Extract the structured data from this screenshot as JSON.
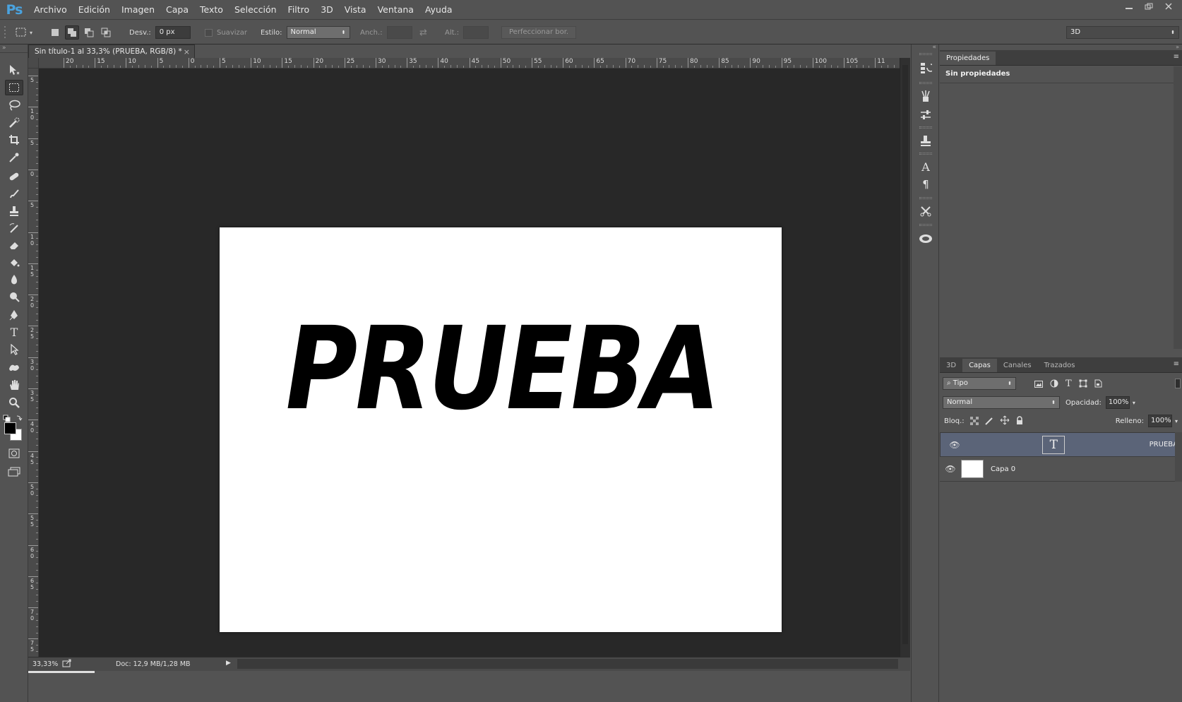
{
  "app": {
    "logo": "Ps"
  },
  "menu": [
    "Archivo",
    "Edición",
    "Imagen",
    "Capa",
    "Texto",
    "Selección",
    "Filtro",
    "3D",
    "Vista",
    "Ventana",
    "Ayuda"
  ],
  "options": {
    "feather_label": "Desv.:",
    "feather_value": "0 px",
    "antialias_label": "Suavizar",
    "style_label": "Estilo:",
    "style_value": "Normal",
    "width_label": "Anch.:",
    "height_label": "Alt.:",
    "refine_label": "Perfeccionar bor.",
    "workspace_value": "3D"
  },
  "document": {
    "tab_title": "Sin título-1 al 33,3% (PRUEBA, RGB/8) *",
    "close": "×",
    "canvas_text": "PRUEBA",
    "ruler_h": [
      "20",
      "15",
      "10",
      "5",
      "0",
      "5",
      "10",
      "15",
      "20",
      "25",
      "30",
      "35",
      "40",
      "45",
      "50",
      "55",
      "60",
      "65",
      "70",
      "75",
      "80",
      "85",
      "90",
      "95",
      "100",
      "105",
      "11"
    ],
    "ruler_v": [
      "5",
      "1\n0",
      "5",
      "0",
      "5",
      "1\n0",
      "1\n5",
      "2\n0",
      "2\n5",
      "3\n0",
      "3\n5",
      "4\n0",
      "4\n5",
      "5\n0",
      "5\n5",
      "6\n0",
      "6\n5",
      "7\n0",
      "7\n5"
    ]
  },
  "status": {
    "zoom": "33,33%",
    "doc": "Doc: 12,9 MB/1,28 MB"
  },
  "properties": {
    "tab": "Propiedades",
    "content": "Sin propiedades"
  },
  "layers_panel": {
    "tabs": [
      "3D",
      "Capas",
      "Canales",
      "Trazados"
    ],
    "active_tab": "Capas",
    "filter_value": "Tipo",
    "blend_value": "Normal",
    "opacity_label": "Opacidad:",
    "opacity_value": "100%",
    "lock_label": "Bloq.:",
    "fill_label": "Relleno:",
    "fill_value": "100%",
    "layers": [
      {
        "name": "PRUEBA",
        "kind": "text",
        "selected": true
      },
      {
        "name": "Capa 0",
        "kind": "pixel",
        "selected": false
      }
    ]
  },
  "colors": {
    "accent": "#4aa3df",
    "selected_layer": "#5b6478",
    "canvas_bg": "#282828"
  }
}
